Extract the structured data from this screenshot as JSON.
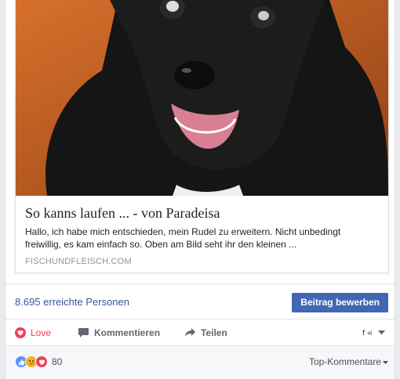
{
  "link_preview": {
    "title": "So kanns laufen ... - von Paradeisa",
    "description": "Hallo, ich habe mich entschieden, mein Rudel zu erweitern. Nicht unbedingt freiwillig, es kam einfach so. Oben am Bild seht ihr den kleinen ...",
    "domain": "FISCHUNDFLEISCH.COM",
    "image_icon": "puppy-photo"
  },
  "insights": {
    "reach_text": "8.695 erreichte Personen",
    "boost_label": "Beitrag bewerben"
  },
  "actions": {
    "love_label": "Love",
    "comment_label": "Kommentieren",
    "share_label": "Teilen",
    "love_color": "#f33e58"
  },
  "reactions": {
    "count": "80",
    "icons": [
      "like-icon",
      "sad-icon",
      "love-icon"
    ]
  },
  "comments_sort": {
    "label": "Top-Kommentare"
  },
  "colors": {
    "accent": "#4267b2",
    "link": "#365899"
  }
}
